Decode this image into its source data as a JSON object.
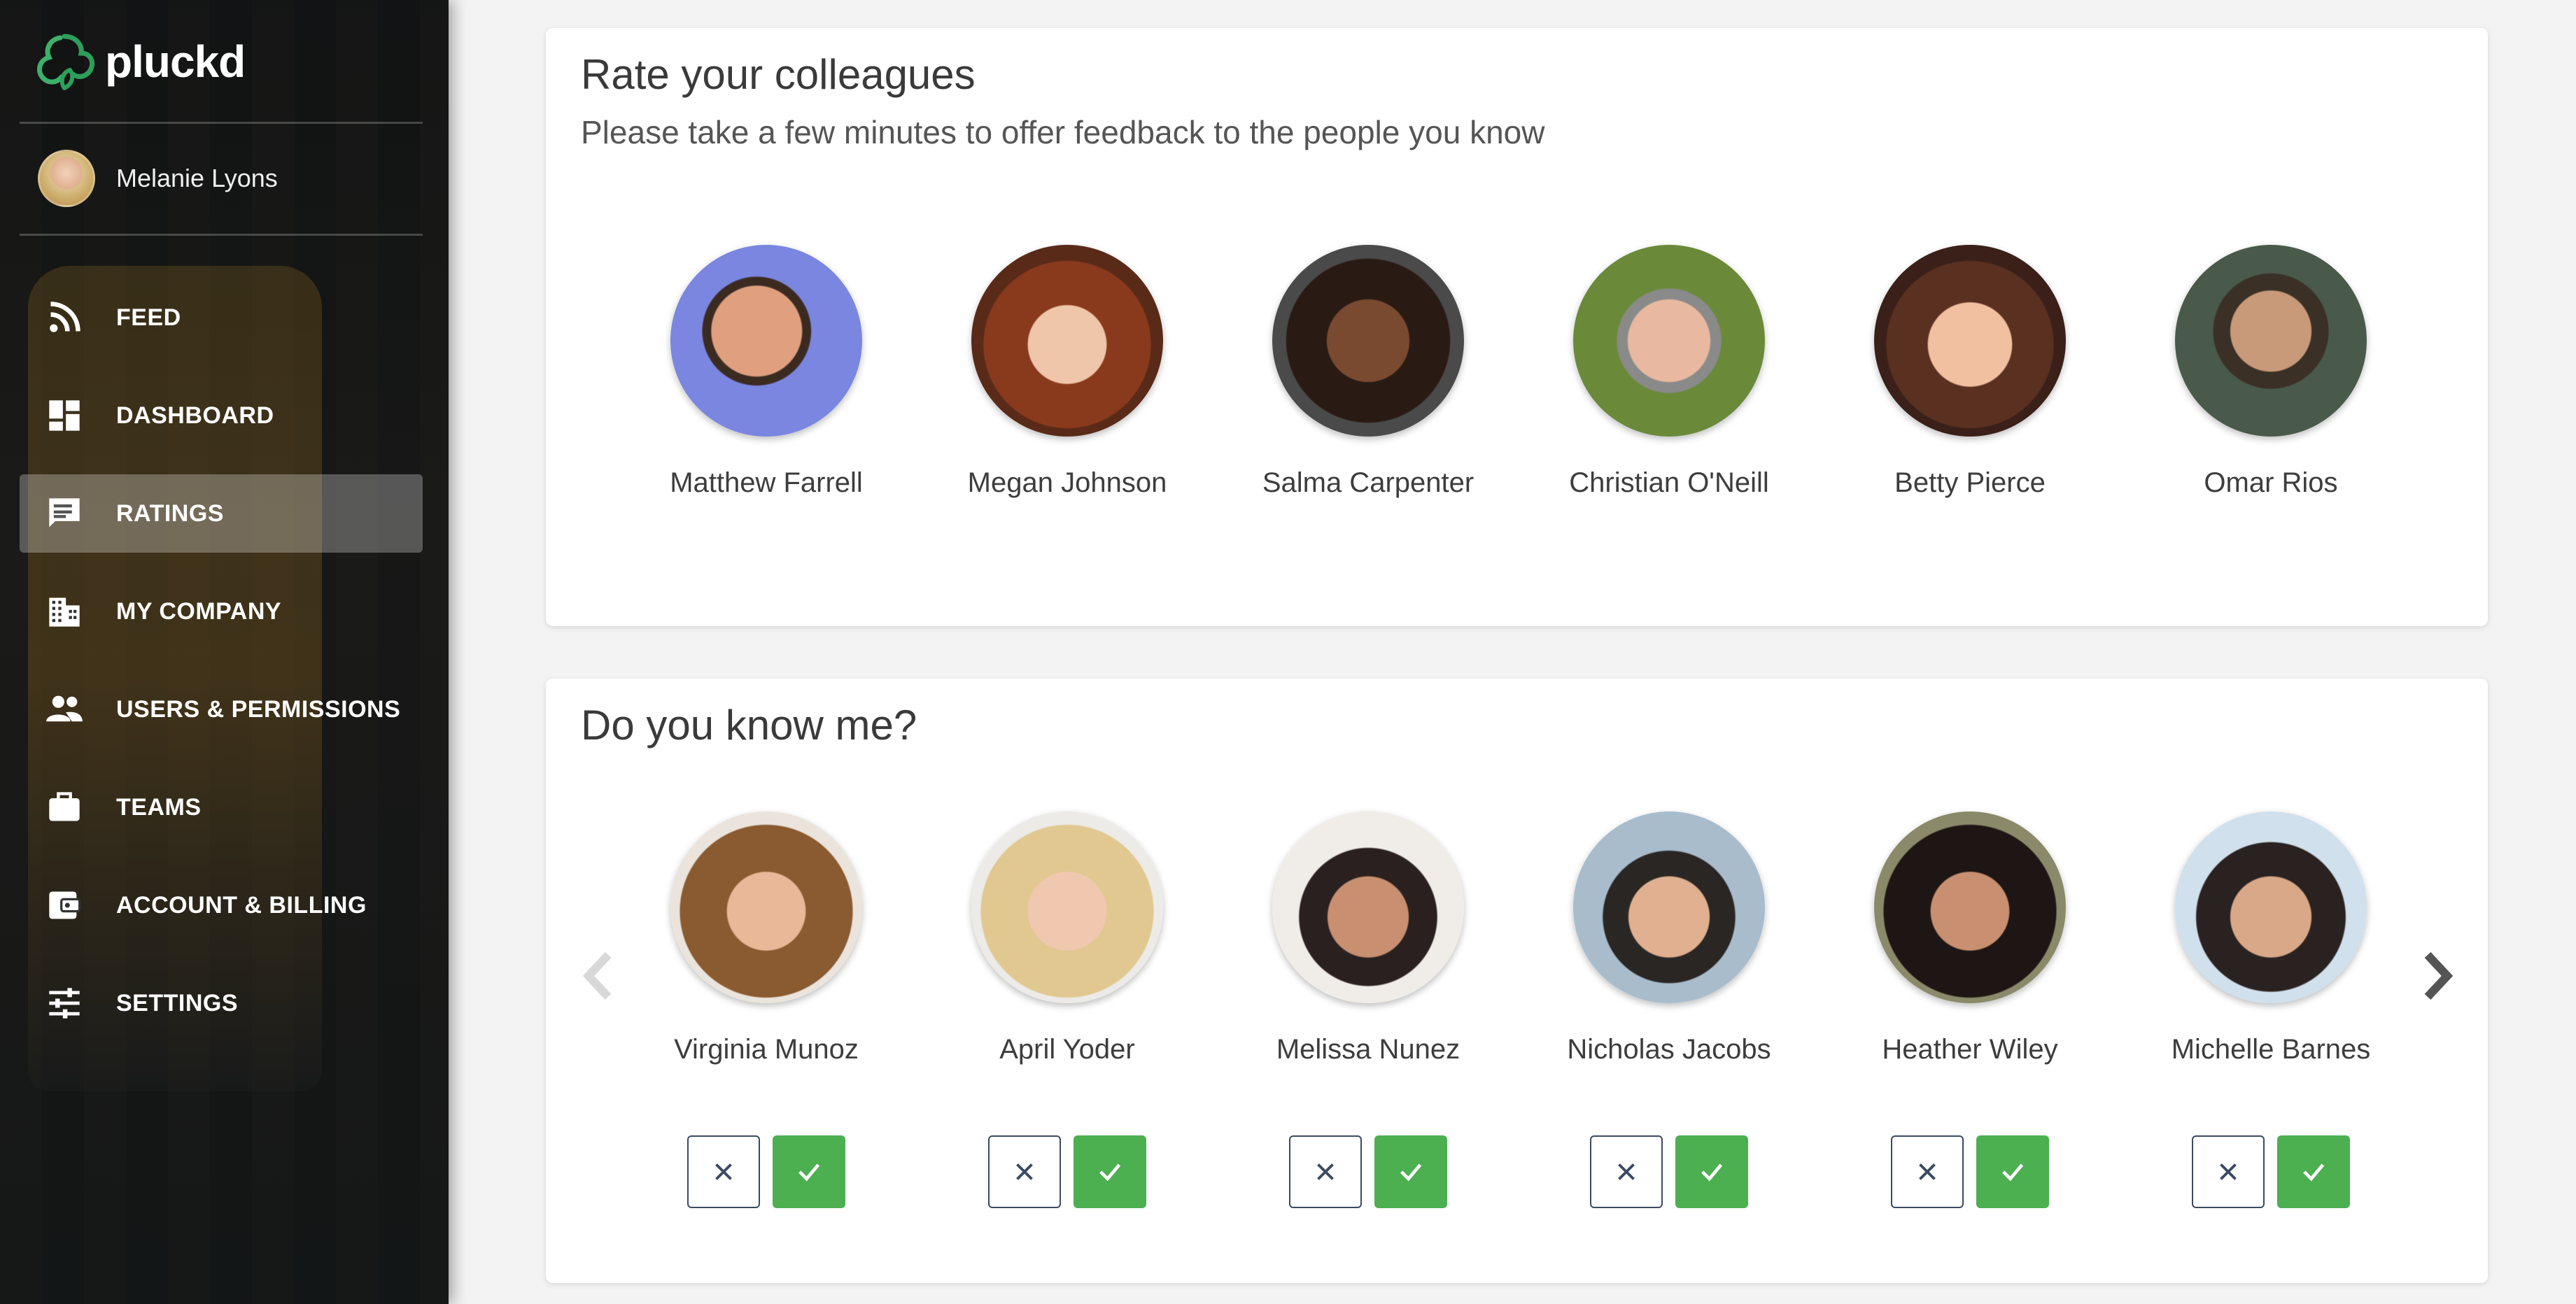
{
  "app": {
    "name": "pluckd"
  },
  "user": {
    "name": "Melanie Lyons"
  },
  "nav": [
    {
      "label": "FEED",
      "icon": "rss-icon",
      "active": false
    },
    {
      "label": "DASHBOARD",
      "icon": "dashboard-icon",
      "active": false
    },
    {
      "label": "RATINGS",
      "icon": "ratings-icon",
      "active": true
    },
    {
      "label": "MY COMPANY",
      "icon": "building-icon",
      "active": false
    },
    {
      "label": "USERS & PERMISSIONS",
      "icon": "people-icon",
      "active": false
    },
    {
      "label": "TEAMS",
      "icon": "briefcase-icon",
      "active": false
    },
    {
      "label": "ACCOUNT & BILLING",
      "icon": "wallet-icon",
      "active": false
    },
    {
      "label": "SETTINGS",
      "icon": "sliders-icon",
      "active": false
    }
  ],
  "rate_section": {
    "title": "Rate your colleagues",
    "subtitle": "Please take a few minutes to offer feedback to the people you know",
    "people": [
      {
        "name": "Matthew Farrell"
      },
      {
        "name": "Megan Johnson"
      },
      {
        "name": "Salma Carpenter"
      },
      {
        "name": "Christian O'Neill"
      },
      {
        "name": "Betty Pierce"
      },
      {
        "name": "Omar Rios"
      }
    ]
  },
  "know_section": {
    "title": "Do you know me?",
    "people": [
      {
        "name": "Virginia Munoz"
      },
      {
        "name": "April Yoder"
      },
      {
        "name": "Melissa Nunez"
      },
      {
        "name": "Nicholas Jacobs"
      },
      {
        "name": "Heather Wiley"
      },
      {
        "name": "Michelle Barnes"
      }
    ]
  },
  "colors": {
    "accent_green": "#4caf50",
    "logo_green": "#2e9e5b",
    "no_button_border": "#3b4a63"
  }
}
